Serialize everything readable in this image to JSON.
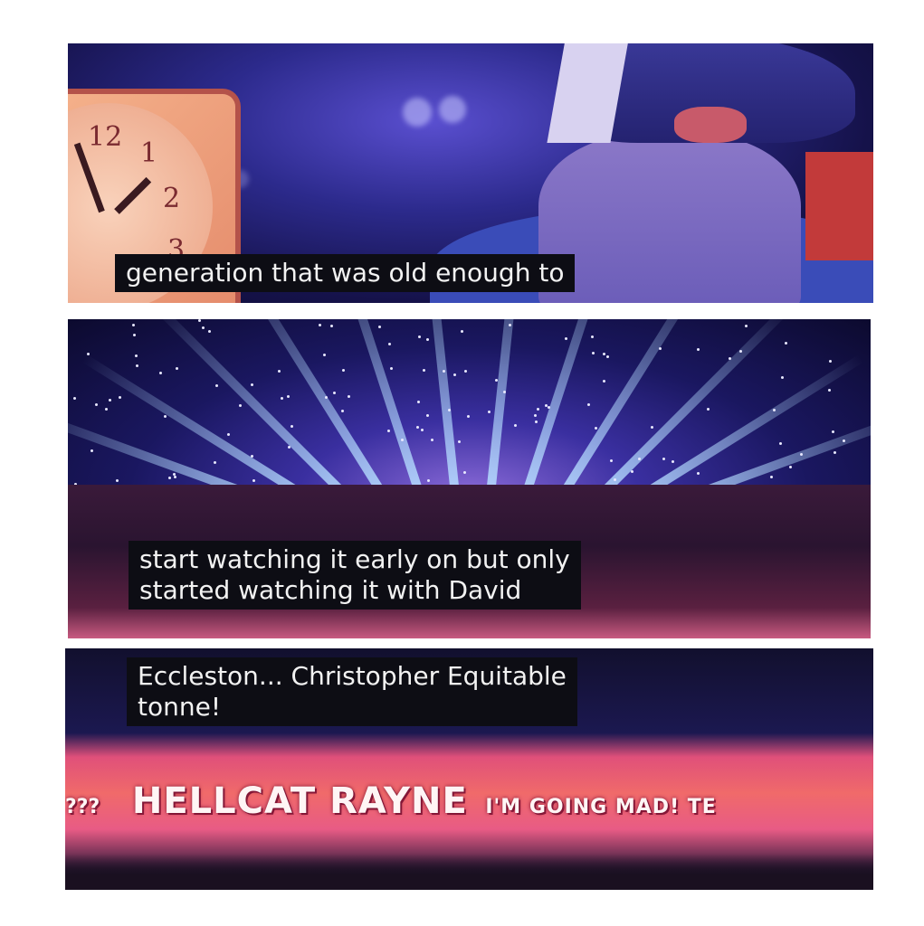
{
  "panels": [
    {
      "subtitle_lines": [
        "generation that was old enough to"
      ],
      "clock_numbers": [
        "12",
        "1",
        "2",
        "3"
      ]
    },
    {
      "subtitle_lines": [
        "start watching it early on but only",
        "started watching it with David"
      ]
    },
    {
      "subtitle_lines": [
        "Eccleston... Christopher Equitable",
        "tonne!"
      ],
      "banner": {
        "prefix": "???",
        "name": "HELLCAT RAYNE",
        "tail": "I'M GOING MAD! TE"
      }
    }
  ],
  "colors": {
    "subtitle_bg": "#0d0d14",
    "subtitle_text": "#f2f2f2",
    "stage_blue": "#3a2fa0",
    "banner_pink": "#f06a6a"
  }
}
